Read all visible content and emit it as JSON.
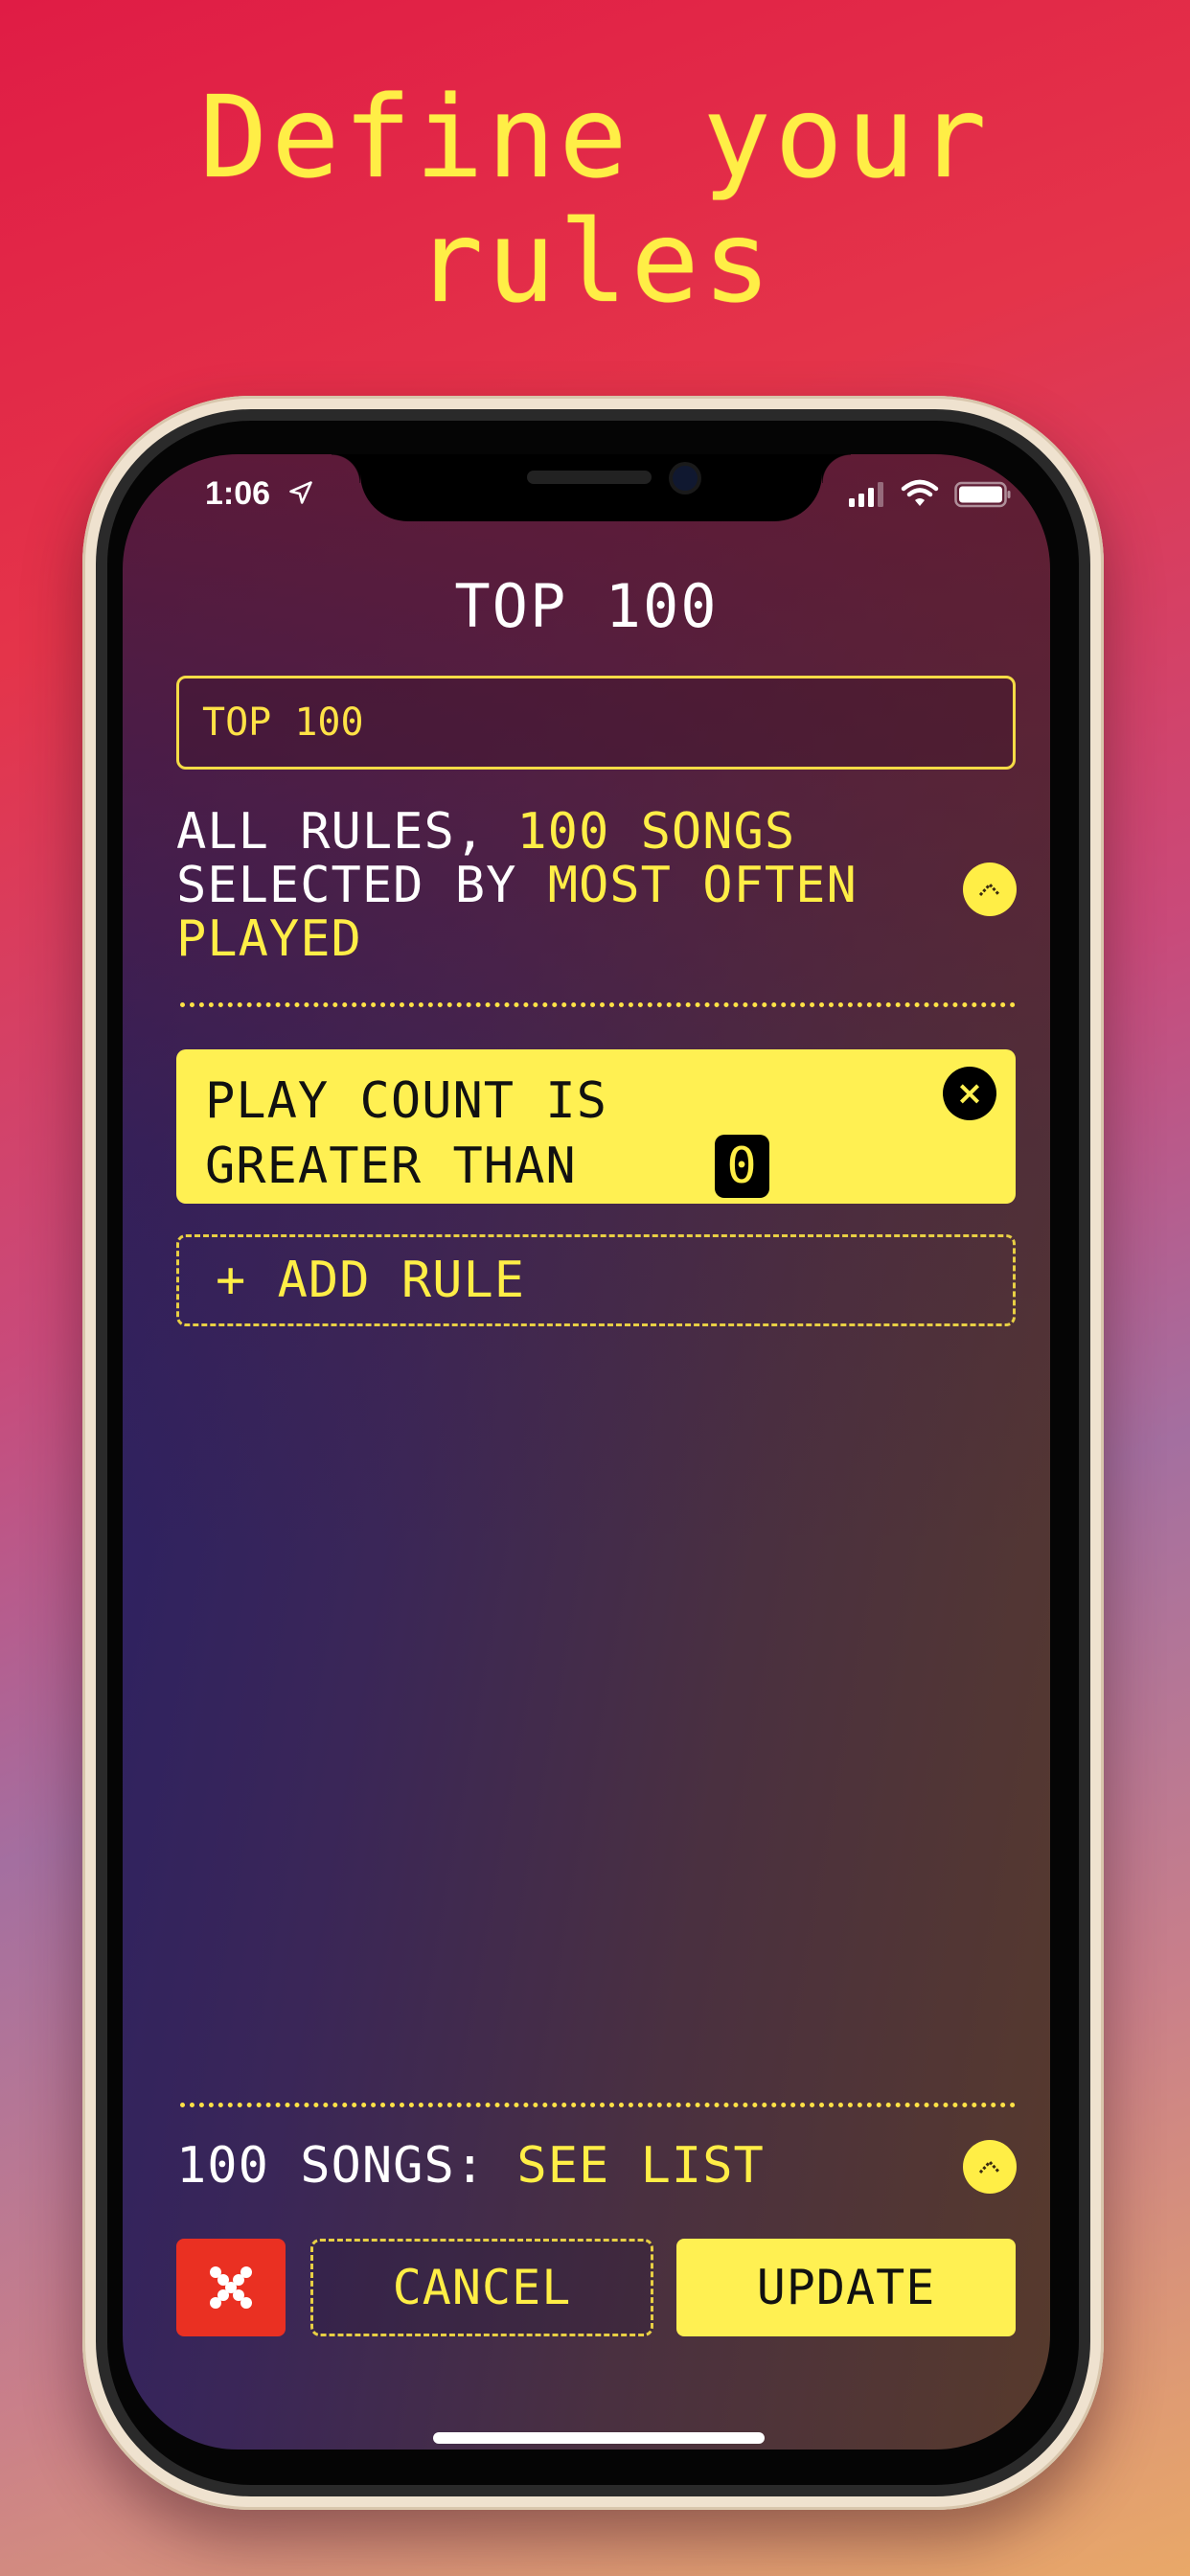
{
  "headline": {
    "line1": "Define your",
    "line2": "rules"
  },
  "status_bar": {
    "time": "1:06",
    "icons": [
      "location-arrow-icon",
      "cellular-signal-icon",
      "wifi-icon",
      "battery-icon"
    ]
  },
  "screen": {
    "title": "TOP 100",
    "name_input": {
      "value": "TOP 100",
      "placeholder": ""
    },
    "summary": {
      "part1": "ALL RULES, ",
      "songs_count": "100 SONGS",
      "part2": "SELECTED BY ",
      "order": "MOST OFTEN PLAYED"
    },
    "rules": [
      {
        "text": "PLAY COUNT IS GREATER THAN",
        "value": "0",
        "remove_label": "×"
      }
    ],
    "add_rule_label": "+ ADD RULE",
    "songs_row": {
      "count_label": "100 SONGS:",
      "link_label": "SEE LIST"
    },
    "buttons": {
      "delete_icon": "x-icon",
      "cancel_label": "CANCEL",
      "update_label": "UPDATE"
    }
  },
  "colors": {
    "accent_yellow": "#fff052",
    "delete_red": "#ea3022",
    "text_white": "#ffffff"
  }
}
